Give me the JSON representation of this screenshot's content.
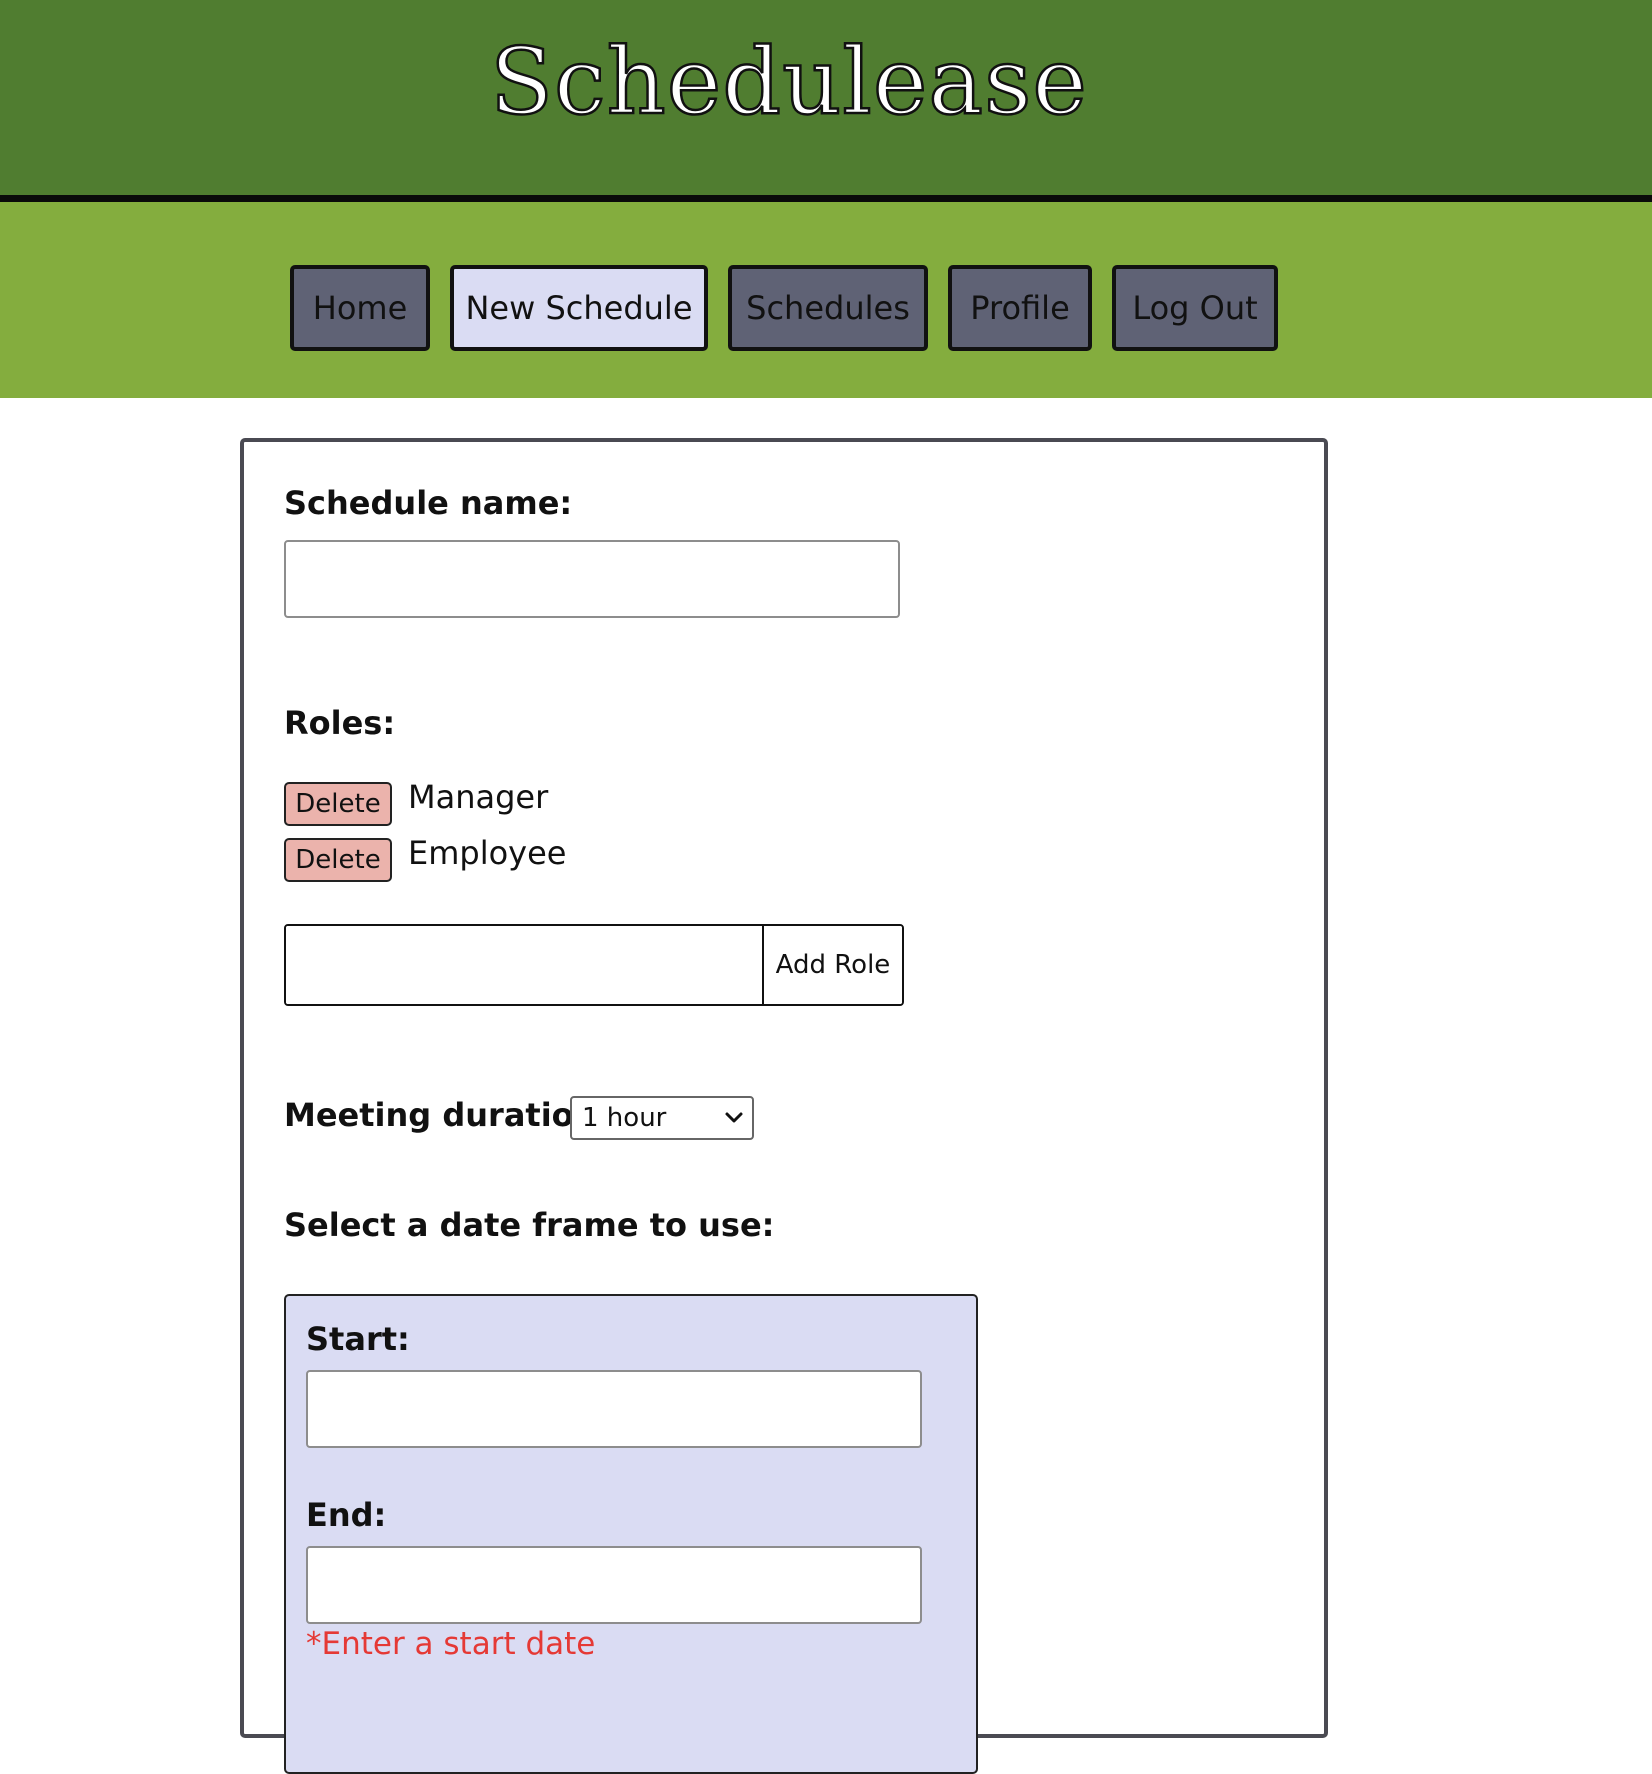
{
  "app": {
    "title": "Schedulease"
  },
  "nav": {
    "items": [
      {
        "label": "Home"
      },
      {
        "label": "New Schedule"
      },
      {
        "label": "Schedules"
      },
      {
        "label": "Profile"
      },
      {
        "label": "Log Out"
      }
    ],
    "active": "New Schedule"
  },
  "form": {
    "schedule_name_label": "Schedule name:",
    "schedule_name_value": "",
    "roles_label": "Roles:",
    "roles": [
      {
        "delete_label": "Delete",
        "name": "Manager"
      },
      {
        "delete_label": "Delete",
        "name": "Employee"
      }
    ],
    "new_role_value": "",
    "add_role_label": "Add Role",
    "meeting_duration_label": "Meeting duration:",
    "meeting_duration_value": "1 hour",
    "date_frame_label": "Select a date frame to use:",
    "start_label": "Start:",
    "start_value": "",
    "end_label": "End:",
    "end_value": "",
    "error": "*Enter a start date"
  },
  "colors": {
    "header_bg": "#507d30",
    "nav_bg": "#84ad3e",
    "nav_button_bg": "#5f6275",
    "nav_button_active_bg": "#dadcf3",
    "delete_button_bg": "#ebb3ac",
    "date_box_bg": "#dadcf3",
    "error_text": "#e53935"
  },
  "icons": {
    "select_arrow": "chevron-down-icon"
  }
}
